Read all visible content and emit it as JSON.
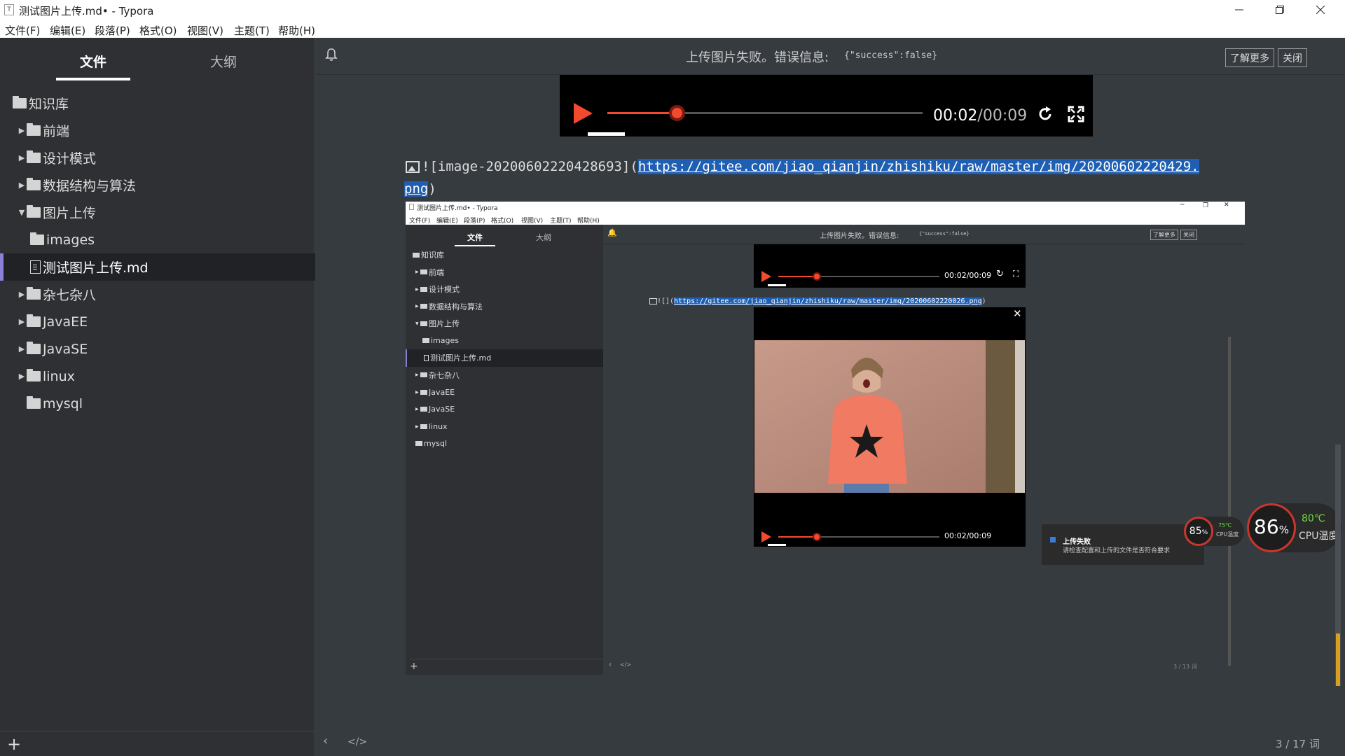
{
  "window": {
    "title": "测试图片上传.md• - Typora",
    "app_icon": "T"
  },
  "menu": [
    "文件(F)",
    "编辑(E)",
    "段落(P)",
    "格式(O)",
    "视图(V)",
    "主题(T)",
    "帮助(H)"
  ],
  "sidebar": {
    "tab_files": "文件",
    "tab_outline": "大纲",
    "items": [
      {
        "label": "知识库",
        "type": "folder",
        "level": 0,
        "arrow": ""
      },
      {
        "label": "前端",
        "type": "folder",
        "level": 1,
        "arrow": "▶"
      },
      {
        "label": "设计模式",
        "type": "folder",
        "level": 1,
        "arrow": "▶"
      },
      {
        "label": "数据结构与算法",
        "type": "folder",
        "level": 1,
        "arrow": "▶"
      },
      {
        "label": "图片上传",
        "type": "folder",
        "level": 1,
        "arrow": "▼"
      },
      {
        "label": "images",
        "type": "folder",
        "level": 2,
        "arrow": ""
      },
      {
        "label": "测试图片上传.md",
        "type": "file",
        "level": 2,
        "arrow": "",
        "active": true
      },
      {
        "label": "杂七杂八",
        "type": "folder",
        "level": 1,
        "arrow": "▶"
      },
      {
        "label": "JavaEE",
        "type": "folder",
        "level": 1,
        "arrow": "▶"
      },
      {
        "label": "JavaSE",
        "type": "folder",
        "level": 1,
        "arrow": "▶"
      },
      {
        "label": "linux",
        "type": "folder",
        "level": 1,
        "arrow": "▶"
      },
      {
        "label": "mysql",
        "type": "folder",
        "level": 1,
        "arrow": ""
      }
    ],
    "add_icon": "+"
  },
  "notification": {
    "message": "上传图片失败。错误信息:",
    "code": "{\"success\":false}",
    "learn_more": "了解更多",
    "close": "关闭"
  },
  "video": {
    "time_current": "00:02",
    "time_total": "/00:09",
    "progress": 0.22
  },
  "editor": {
    "line1_prefix": "![image-20200602220428693](",
    "line1_url": "https://gitee.com/jiao_qianjin/zhishiku/raw/master/img/20200602220429.",
    "line2_url": "png",
    "line2_suffix": ")"
  },
  "footer": {
    "word_count": "3 / 17 词"
  },
  "screenshot": {
    "title": "测试图片上传.md• - Typora",
    "menu": [
      "文件(F)",
      "编辑(E)",
      "段落(P)",
      "格式(O)",
      "视图(V)",
      "主题(T)",
      "帮助(H)"
    ],
    "tab_files": "文件",
    "tab_outline": "大纲",
    "items": [
      "知识库",
      "前端",
      "设计模式",
      "数据结构与算法",
      "图片上传",
      "images",
      "测试图片上传.md",
      "杂七杂八",
      "JavaEE",
      "JavaSE",
      "linux",
      "mysql"
    ],
    "notif_message": "上传图片失败。错误信息:",
    "notif_code": "{\"success\":false}",
    "learn_more": "了解更多",
    "close": "关闭",
    "video_time": "00:02/00:09",
    "md_line": "![](",
    "md_url": "https://gitee.com/jiao_qianjin/zhishiku/raw/master/img/20200602220026.png",
    "md_suffix": ")",
    "toast_title": "上传失败",
    "toast_body": "请检查配置和上传的文件是否符合要求",
    "word_count": "3 / 13 词"
  },
  "gauges": {
    "small_percent": "85",
    "small_unit": "%",
    "small_temp": "75℃",
    "small_label": "CPU温度",
    "big_percent": "86",
    "big_unit": "%",
    "big_temp": "80℃",
    "big_label": "CPU温度"
  }
}
